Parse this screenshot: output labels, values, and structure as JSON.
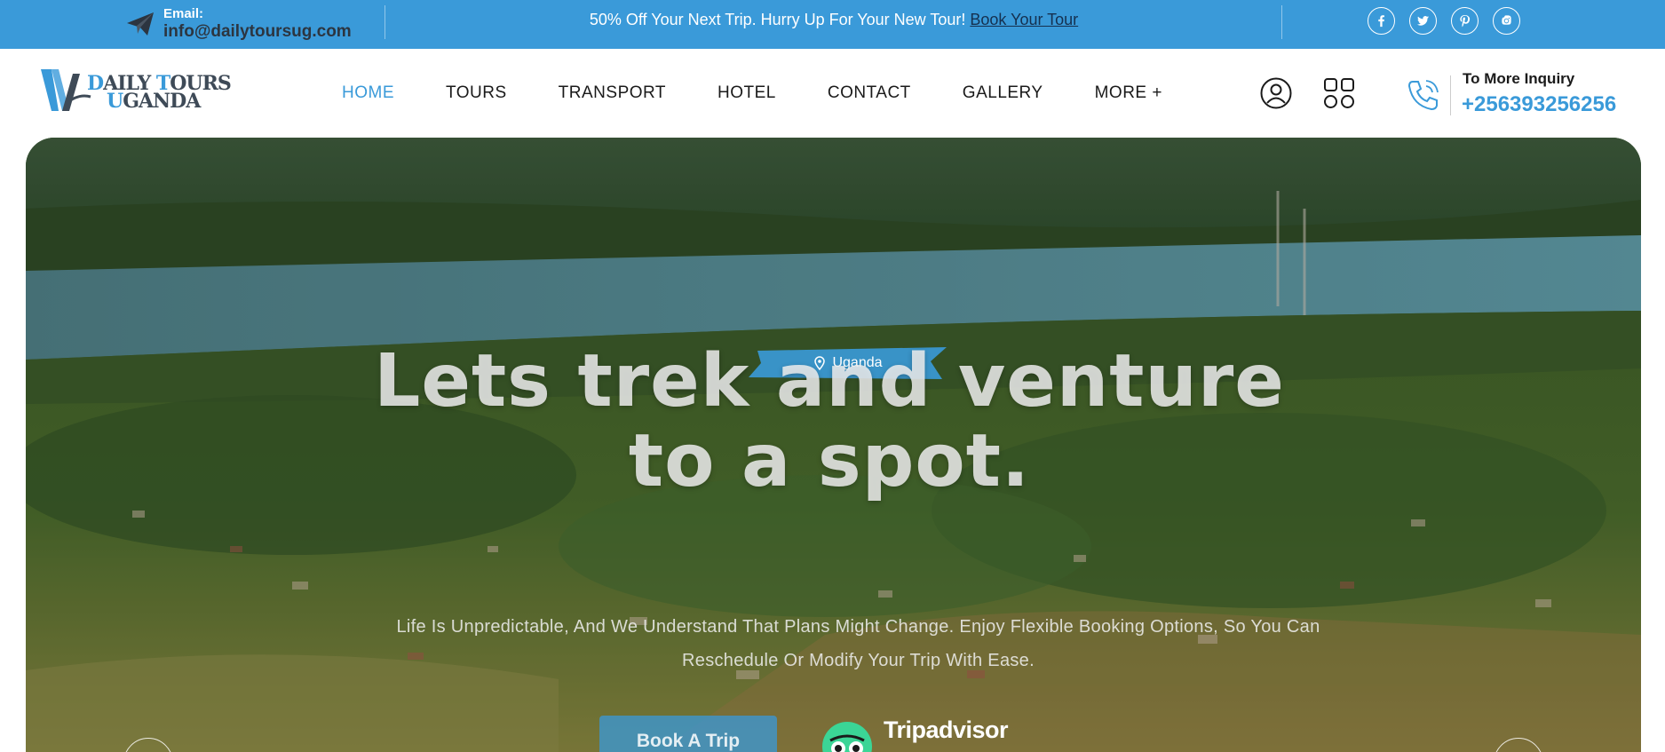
{
  "topbar": {
    "email_label": "Email:",
    "email_value": "info@dailytoursug.com",
    "promo_text": "50% Off Your Next Trip. Hurry Up For Your New Tour!",
    "promo_link": "Book Your Tour",
    "social_icons": [
      "facebook-icon",
      "twitter-icon",
      "pinterest-icon",
      "instagram-icon"
    ]
  },
  "header": {
    "logo_line1": "DAILY TOURS",
    "logo_line2": "UGANDA",
    "nav": [
      {
        "label": "HOME",
        "active": true
      },
      {
        "label": "TOURS"
      },
      {
        "label": "TRANSPORT"
      },
      {
        "label": "HOTEL"
      },
      {
        "label": "CONTACT"
      },
      {
        "label": "GALLERY"
      },
      {
        "label": "MORE +"
      }
    ],
    "inquiry_label": "To More Inquiry",
    "inquiry_phone": "+256393256256"
  },
  "hero": {
    "badge": "Uganda",
    "title": "Lets trek and venture to a spot.",
    "subtitle": "Life Is Unpredictable, And We Understand That Plans Might Change. Enjoy Flexible Booking Options, So You Can Reschedule Or Modify Your Trip With Ease.",
    "cta_label": "Book A Trip",
    "review_brand": "Tripadvisor"
  },
  "colors": {
    "accent": "#3a9ad9",
    "topbar_bg": "#3a9ad9",
    "nav_text": "#1a1a1a",
    "tripadvisor_green": "#34e0a1"
  }
}
